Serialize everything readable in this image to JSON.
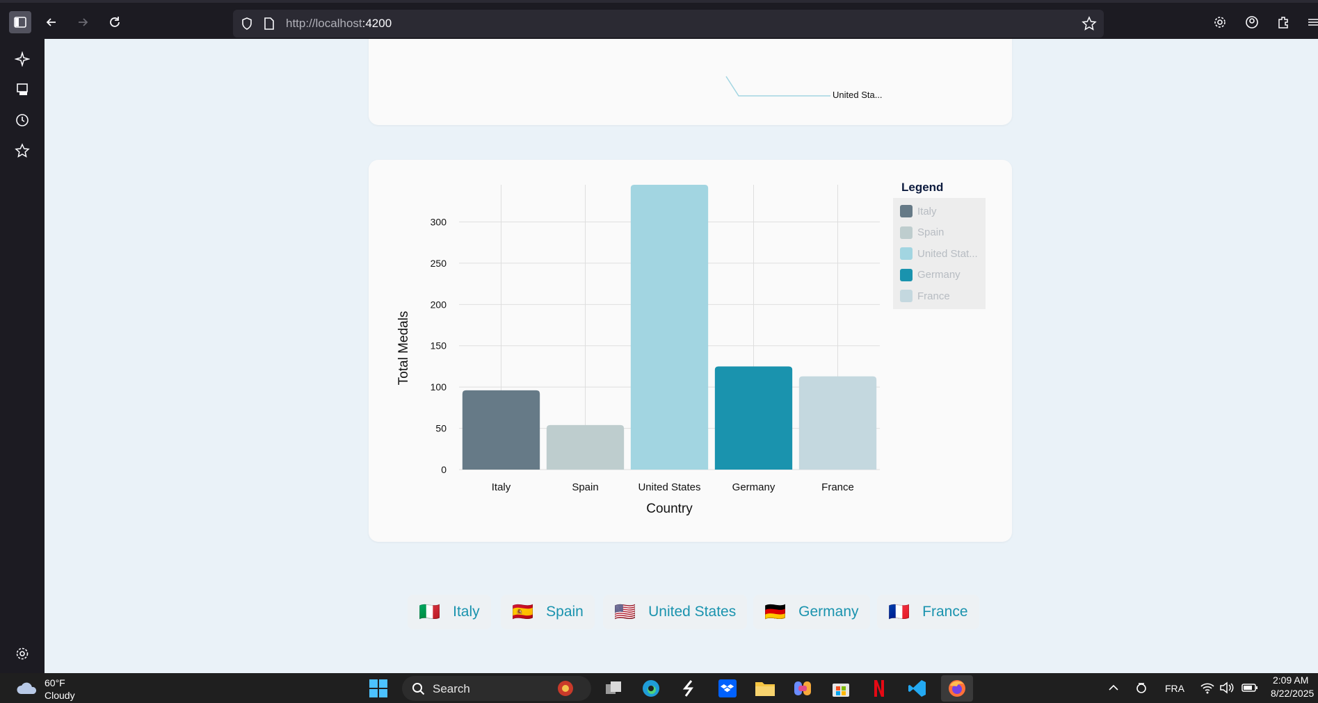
{
  "browser": {
    "url_host": "http://localhost",
    "url_port": ":4200"
  },
  "top_chart": {
    "partial_label": "United Sta..."
  },
  "chart_data": {
    "type": "bar",
    "categories": [
      "Italy",
      "Spain",
      "United States",
      "Germany",
      "France"
    ],
    "values": [
      96,
      54,
      345,
      125,
      113
    ],
    "xlabel": "Country",
    "ylabel": "Total Medals",
    "ylim": [
      0,
      345
    ],
    "yticks": [
      0,
      50,
      100,
      150,
      200,
      250,
      300
    ],
    "colors": [
      "#667a87",
      "#becdce",
      "#a2d5e1",
      "#1a93ae",
      "#c4d8df"
    ],
    "grid": true,
    "legend": {
      "title": "Legend",
      "placement": "right",
      "entries": [
        "Italy",
        "Spain",
        "United Stat...",
        "Germany",
        "France"
      ]
    }
  },
  "country_buttons": [
    {
      "flag": "🇮🇹",
      "label": "Italy"
    },
    {
      "flag": "🇪🇸",
      "label": "Spain"
    },
    {
      "flag": "🇺🇸",
      "label": "United States"
    },
    {
      "flag": "🇩🇪",
      "label": "Germany"
    },
    {
      "flag": "🇫🇷",
      "label": "France"
    }
  ],
  "taskbar": {
    "weather_temp": "60°F",
    "weather_cond": "Cloudy",
    "search_label": "Search",
    "language": "FRA",
    "time": "2:09 AM",
    "date": "8/22/2025"
  }
}
